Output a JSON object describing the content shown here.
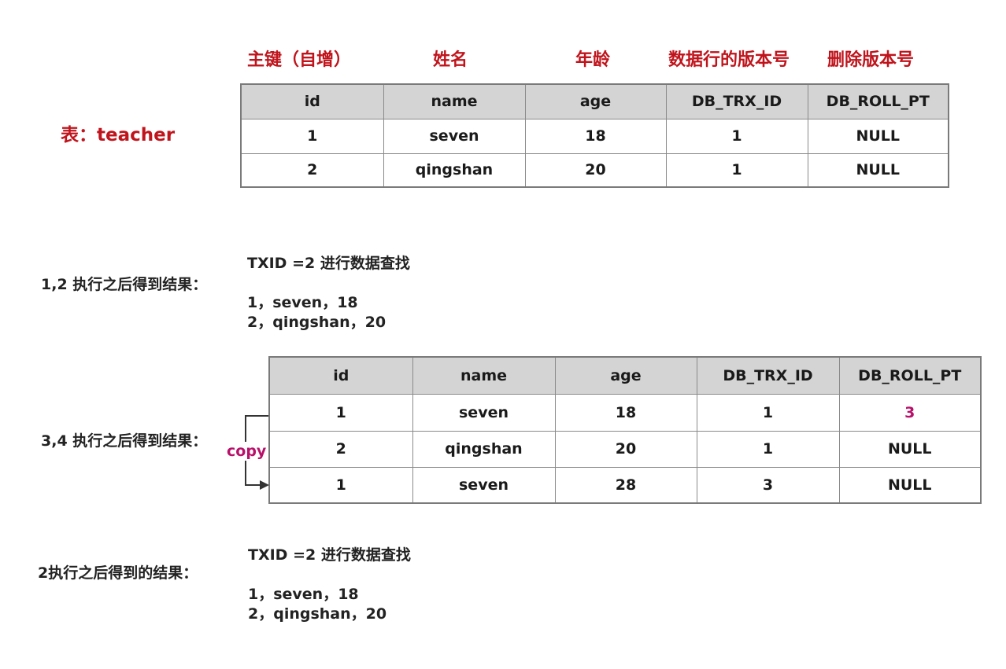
{
  "column_notes": [
    "主键（自增）",
    "姓名",
    "年龄",
    "数据行的版本号",
    "删除版本号"
  ],
  "table_label": "表：teacher",
  "columns": [
    "id",
    "name",
    "age",
    "DB_TRX_ID",
    "DB_ROLL_PT"
  ],
  "table1": {
    "rows": [
      [
        "1",
        "seven",
        "18",
        "1",
        "NULL"
      ],
      [
        "2",
        "qingshan",
        "20",
        "1",
        "NULL"
      ]
    ]
  },
  "step1": {
    "label": "1,2 执行之后得到结果：",
    "query": "TXID =2   进行数据查找",
    "results": [
      "1，seven，18",
      "2，qingshan，20"
    ]
  },
  "step2": {
    "label": "3,4 执行之后得到结果：",
    "copy_label": "copy",
    "rows": [
      [
        "1",
        "seven",
        "18",
        "1",
        "3"
      ],
      [
        "2",
        "qingshan",
        "20",
        "1",
        "NULL"
      ],
      [
        "1",
        "seven",
        "28",
        "3",
        "NULL"
      ]
    ],
    "highlight_color": "#b8106a"
  },
  "step3": {
    "label": "2执行之后得到的结果：",
    "query": "TXID =2 进行数据查找",
    "results": [
      "1，seven，18",
      "2，qingshan，20"
    ]
  },
  "colors": {
    "header_red": "#c0141c",
    "header_fill": "#d4d4d4",
    "copy_magenta": "#b8106a"
  }
}
